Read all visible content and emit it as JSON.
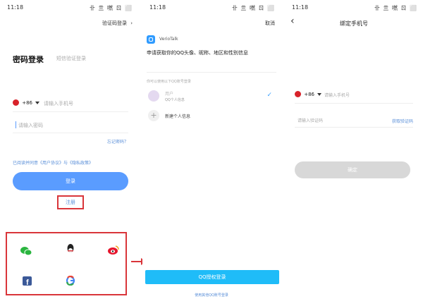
{
  "screen1": {
    "status_time": "11:18",
    "status_icons": "卝 亖 嘫 ㄖ ⬜",
    "top_link": "验证码登录",
    "tab_active": "密码登录",
    "tab_inactive": "短信验证登录",
    "country_code": "+86",
    "phone_placeholder": "请输入手机号",
    "password_placeholder": "请输入密码",
    "forgot_password": "忘记密码？",
    "agreement": "已阅读并同意《用户协议》与《隐私政策》",
    "login_button": "登录",
    "register_link": "注册"
  },
  "screen2": {
    "status_time": "11:18",
    "status_icons": "卝 亖 嘫 ㄖ ⬜",
    "top_right": "取消",
    "app_name": "VerioTalk",
    "permission_text": "申请获取你的QQ头像、昵称、地区和性别信息",
    "section_label": "你可以使用以下QQ账号登录",
    "account_name": "用户",
    "account_sub": "QQ个人信息",
    "add_account": "新建个人信息",
    "confirm_button": "QQ授权登录",
    "bottom_link": "使用其他QQ账号登录"
  },
  "screen3": {
    "status_time": "11:18",
    "status_icons": "卝 亖 嘫 ㄖ ⬜",
    "title": "绑定手机号",
    "country_code": "+86",
    "phone_placeholder": "请输入手机号",
    "code_placeholder": "请输入验证码",
    "get_code": "获取验证码",
    "confirm_button": "确定"
  }
}
